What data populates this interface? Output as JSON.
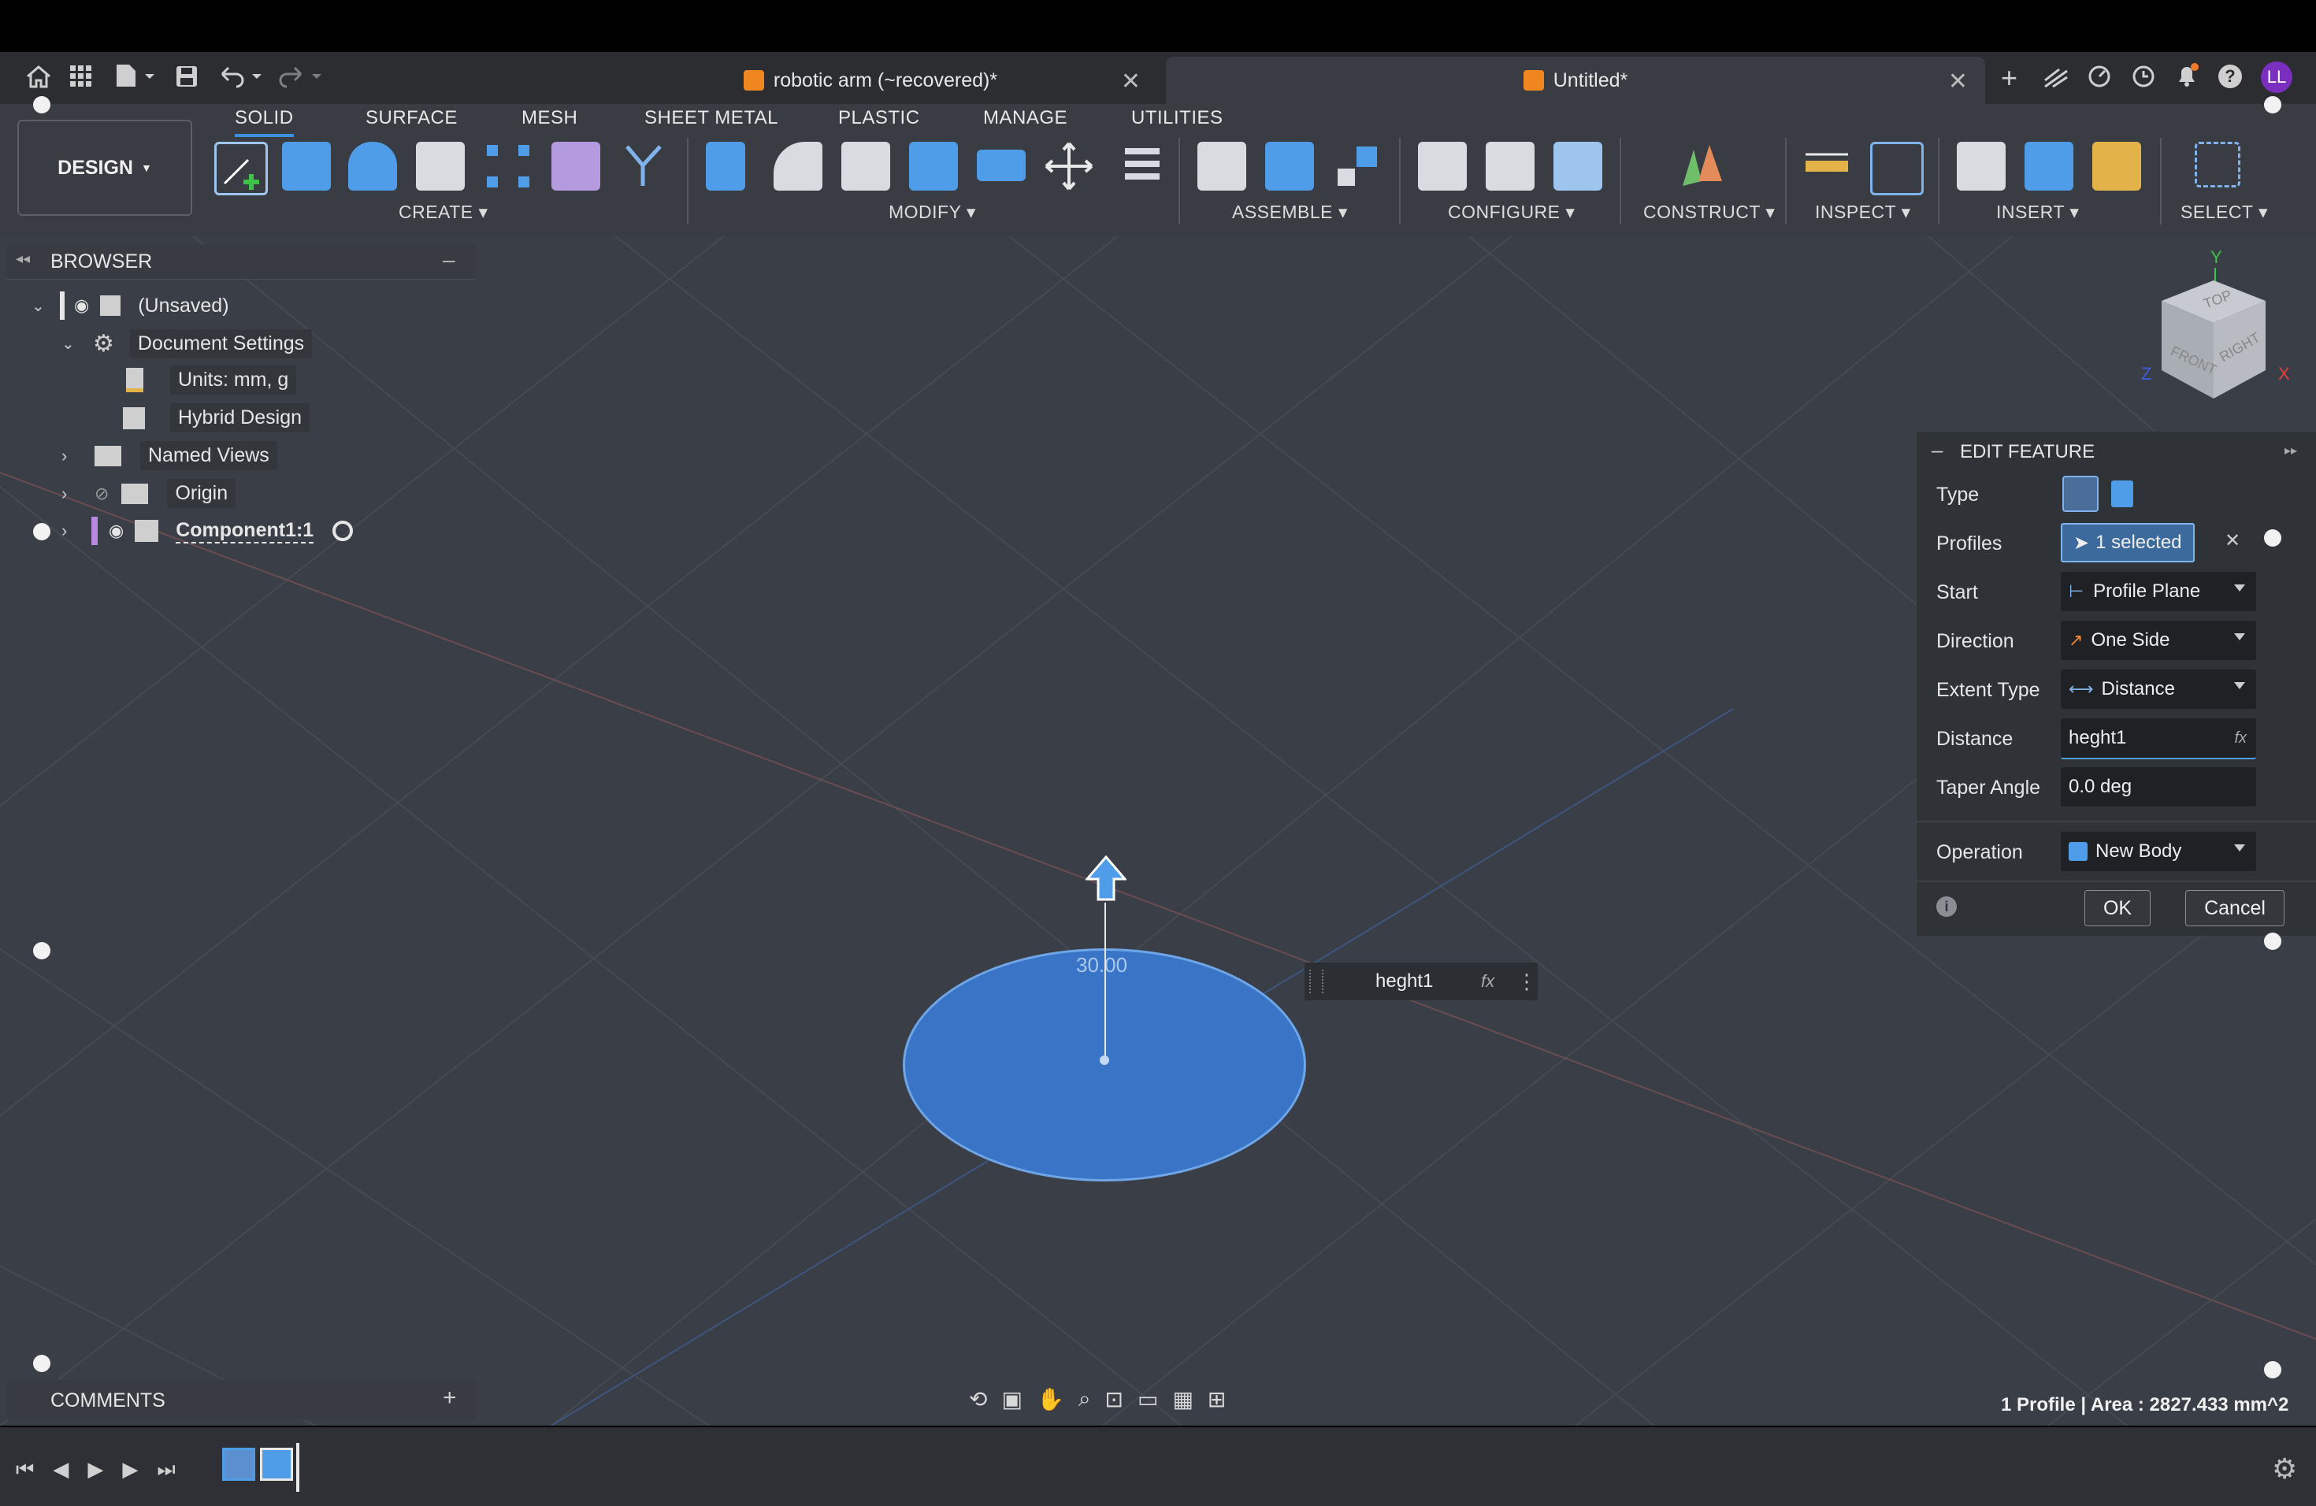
{
  "window": {
    "tabs": [
      {
        "label": "robotic arm (~recovered)*",
        "active": false
      },
      {
        "label": "Untitled*",
        "active": true
      }
    ],
    "avatar": "LL"
  },
  "toolbar": {
    "workspace": "DESIGN",
    "tabs": [
      "SOLID",
      "SURFACE",
      "MESH",
      "SHEET METAL",
      "PLASTIC",
      "MANAGE",
      "UTILITIES"
    ],
    "groups": [
      "CREATE",
      "MODIFY",
      "ASSEMBLE",
      "CONFIGURE",
      "CONSTRUCT",
      "INSPECT",
      "INSERT",
      "SELECT"
    ]
  },
  "browser": {
    "title": "BROWSER",
    "items": [
      {
        "label": "(Unsaved)"
      },
      {
        "label": "Document Settings"
      },
      {
        "label": "Units: mm, g"
      },
      {
        "label": "Hybrid Design"
      },
      {
        "label": "Named Views"
      },
      {
        "label": "Origin"
      },
      {
        "label": "Component1:1"
      }
    ]
  },
  "viewcube": {
    "top": "TOP",
    "front": "FRONT",
    "right": "RIGHT",
    "axis_y": "Y",
    "axis_z": "Z",
    "axis_x": "X"
  },
  "canvas": {
    "dimension_value": "30.00",
    "inline_input": "heght1",
    "fx": "fx"
  },
  "edit_feature": {
    "title": "EDIT FEATURE",
    "rows": {
      "type": "Type",
      "profiles": "Profiles",
      "start": "Start",
      "direction": "Direction",
      "extent_type": "Extent Type",
      "distance": "Distance",
      "taper_angle": "Taper Angle",
      "operation": "Operation"
    },
    "values": {
      "profiles": "1 selected",
      "start": "Profile Plane",
      "direction": "One Side",
      "extent_type": "Distance",
      "distance": "heght1",
      "taper_angle": "0.0 deg",
      "operation": "New Body"
    },
    "fx": "fx",
    "ok": "OK",
    "cancel": "Cancel"
  },
  "comments": {
    "title": "COMMENTS"
  },
  "status": "1 Profile | Area : 2827.433 mm^2",
  "colors": {
    "accent": "#3f8fe0",
    "profile_fill": "#3a74c6",
    "avatar": "#7b2fbf"
  }
}
